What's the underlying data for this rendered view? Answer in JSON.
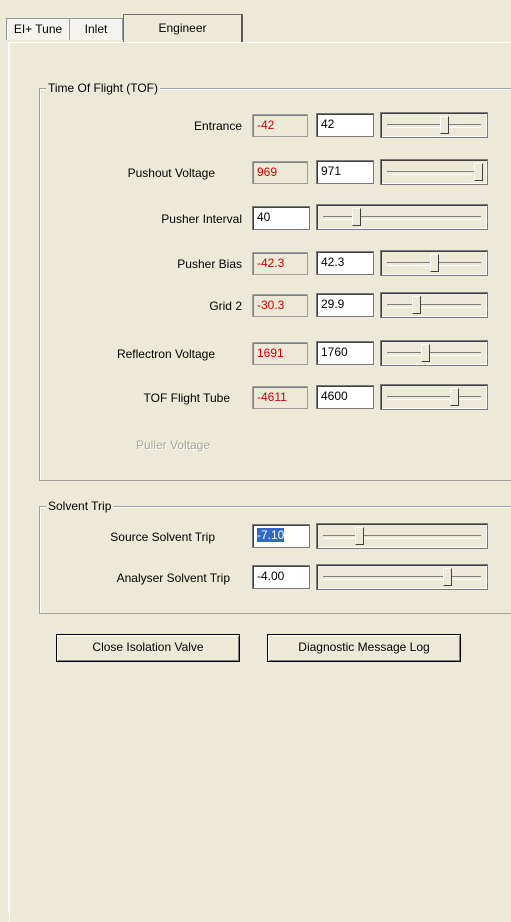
{
  "tabs": [
    {
      "label": "EI+ Tune"
    },
    {
      "label": "Inlet"
    },
    {
      "label": "Engineer"
    }
  ],
  "tof_group": {
    "title": "Time Of Flight (TOF)",
    "rows": [
      {
        "label": "Entrance",
        "readback": "-42",
        "setpoint": "42",
        "slider_level": 0.62
      },
      {
        "label": "Pushout Voltage",
        "readback": "969",
        "setpoint": "971",
        "slider_level": 1.0
      },
      {
        "label": "Pusher Interval",
        "readback": "",
        "setpoint": "40",
        "slider_level": 0.2
      },
      {
        "label": "Pusher Bias",
        "readback": "-42.3",
        "setpoint": "42.3",
        "slider_level": 0.5
      },
      {
        "label": "Grid 2",
        "readback": "-30.3",
        "setpoint": "29.9",
        "slider_level": 0.3
      },
      {
        "label": "Reflectron Voltage",
        "readback": "1691",
        "setpoint": "1760",
        "slider_level": 0.4
      },
      {
        "label": "TOF Flight Tube",
        "readback": "-4611",
        "setpoint": "4600",
        "slider_level": 0.73
      },
      {
        "label": "Puller Voltage",
        "disabled": true
      }
    ]
  },
  "solvent_group": {
    "title": "Solvent Trip",
    "rows": [
      {
        "label": "Source Solvent Trip",
        "setpoint": "-7.10",
        "selected": true,
        "slider_level": 0.22
      },
      {
        "label": "Analyser Solvent Trip",
        "setpoint": "-4.00",
        "slider_level": 0.8
      }
    ]
  },
  "buttons": {
    "close_isolation_valve": "Close Isolation Valve",
    "diagnostic_message_log": "Diagnostic Message Log"
  },
  "colors": {
    "window_bg": "#ece9d8",
    "readback_text": "#d20000",
    "selection": "#316ac5"
  }
}
